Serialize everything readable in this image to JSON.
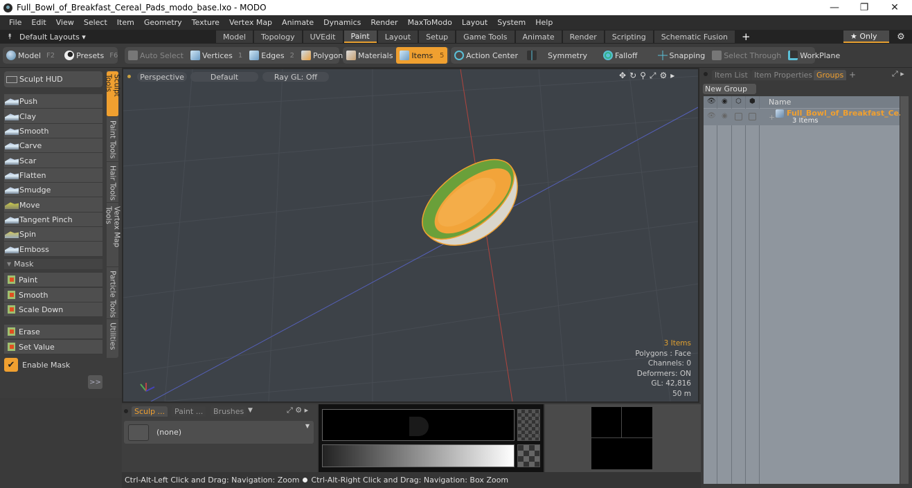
{
  "window": {
    "title": "Full_Bowl_of_Breakfast_Cereal_Pads_modo_base.lxo - MODO",
    "minimize": "—",
    "restore": "❐",
    "close": "✕"
  },
  "menu": [
    "File",
    "Edit",
    "View",
    "Select",
    "Item",
    "Geometry",
    "Texture",
    "Vertex Map",
    "Animate",
    "Dynamics",
    "Render",
    "MaxToModo",
    "Layout",
    "System",
    "Help"
  ],
  "layouts": {
    "selector": "Default Layouts ▾",
    "tabs": [
      "Model",
      "Topology",
      "UVEdit",
      "Paint",
      "Layout",
      "Setup",
      "Game Tools",
      "Animate",
      "Render",
      "Scripting",
      "Schematic Fusion"
    ],
    "active_tab": "Paint",
    "add": "+",
    "only": "★ Only",
    "gear": "⚙"
  },
  "toolbar": {
    "model": {
      "label": "Model",
      "key": "F2"
    },
    "presets": {
      "label": "Presets",
      "key": "F6"
    },
    "auto_select": "Auto Select",
    "vertices": {
      "label": "Vertices",
      "key": "1"
    },
    "edges": {
      "label": "Edges",
      "key": "2"
    },
    "polygons": "Polygons",
    "materials": "Materials",
    "items": {
      "label": "Items",
      "key": "5"
    },
    "action_center": "Action Center",
    "symmetry": "Symmetry",
    "falloff": "Falloff",
    "snapping": "Snapping",
    "select_through": "Select Through",
    "workplane": "WorkPlane"
  },
  "left_panel": {
    "hud": "Sculpt HUD",
    "tools": [
      "Push",
      "Clay",
      "Smooth",
      "Carve",
      "Scar",
      "Flatten",
      "Smudge",
      "Move",
      "Tangent Pinch",
      "Spin",
      "Emboss"
    ],
    "mask_header": "Mask",
    "mask_tools": [
      "Paint",
      "Smooth",
      "Scale Down"
    ],
    "mask_tools2": [
      "Erase",
      "Set Value"
    ],
    "enable_mask": "Enable Mask",
    "enable_mask_checked": true,
    "expand": ">>",
    "vertical_tabs": [
      "Sculpt Tools",
      "Paint Tools",
      "Hair Tools",
      "Vertex Map Tools",
      "Particle Tools",
      "Utilities"
    ],
    "active_vertical_tab": "Sculpt Tools"
  },
  "viewport": {
    "view": "Perspective",
    "shading": "Default",
    "raygl": "Ray GL: Off",
    "info": {
      "items": "3 Items",
      "polygons": "Polygons : Face",
      "channels": "Channels: 0",
      "deformers": "Deformers: ON",
      "gl": "GL: 42,816",
      "scale": "50 m"
    }
  },
  "right_panel": {
    "tabs": [
      "Item List",
      "Item Properties",
      "Groups"
    ],
    "active_tab": "Groups",
    "add": "+",
    "new_group": "New Group",
    "name_header": "Name",
    "group": {
      "name": "Full_Bowl_of_Breakfast_Ce...",
      "count": "3 Items"
    }
  },
  "bottom": {
    "tabs": [
      "Sculp ...",
      "Paint ...",
      "Brushes"
    ],
    "active_tab": "Sculp ...",
    "brush_value": "(none)"
  },
  "status": {
    "left": "Ctrl-Alt-Left Click and Drag: Navigation: Zoom",
    "right": "Ctrl-Alt-Right Click and Drag: Navigation: Box Zoom"
  },
  "colors": {
    "accent": "#f0a030",
    "group_text": "#f0a030",
    "viewport_bg": "#3d4248"
  }
}
